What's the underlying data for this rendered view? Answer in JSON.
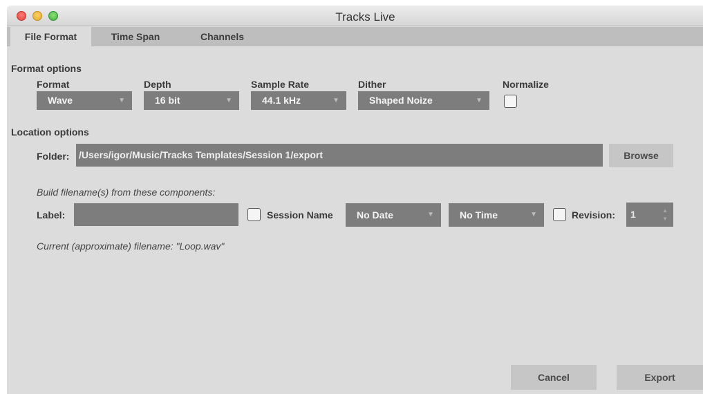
{
  "window": {
    "title": "Tracks Live"
  },
  "tabs": [
    {
      "label": "File Format",
      "active": true
    },
    {
      "label": "Time Span",
      "active": false
    },
    {
      "label": "Channels",
      "active": false
    }
  ],
  "format_options": {
    "section_title": "Format options",
    "format": {
      "label": "Format",
      "value": "Wave"
    },
    "depth": {
      "label": "Depth",
      "value": "16 bit"
    },
    "sample_rate": {
      "label": "Sample Rate",
      "value": "44.1 kHz"
    },
    "dither": {
      "label": "Dither",
      "value": "Shaped Noize"
    },
    "normalize": {
      "label": "Normalize",
      "checked": false
    }
  },
  "location_options": {
    "section_title": "Location options",
    "folder": {
      "label": "Folder:",
      "value": "/Users/igor/Music/Tracks Templates/Session 1/export"
    },
    "browse_label": "Browse"
  },
  "filename": {
    "hint": "Build filename(s) from these components:",
    "label_field": {
      "label": "Label:",
      "value": ""
    },
    "session_name": {
      "label": "Session Name",
      "checked": false
    },
    "date": {
      "value": "No Date"
    },
    "time": {
      "value": "No Time"
    },
    "revision": {
      "label": "Revision:",
      "checked": false,
      "value": "1"
    },
    "current": "Current (approximate) filename: \"Loop.wav\""
  },
  "actions": {
    "cancel_label": "Cancel",
    "export_label": "Export"
  },
  "icons": {
    "dropdown_arrow": "▼",
    "stepper_up": "▲",
    "stepper_down": "▼"
  }
}
